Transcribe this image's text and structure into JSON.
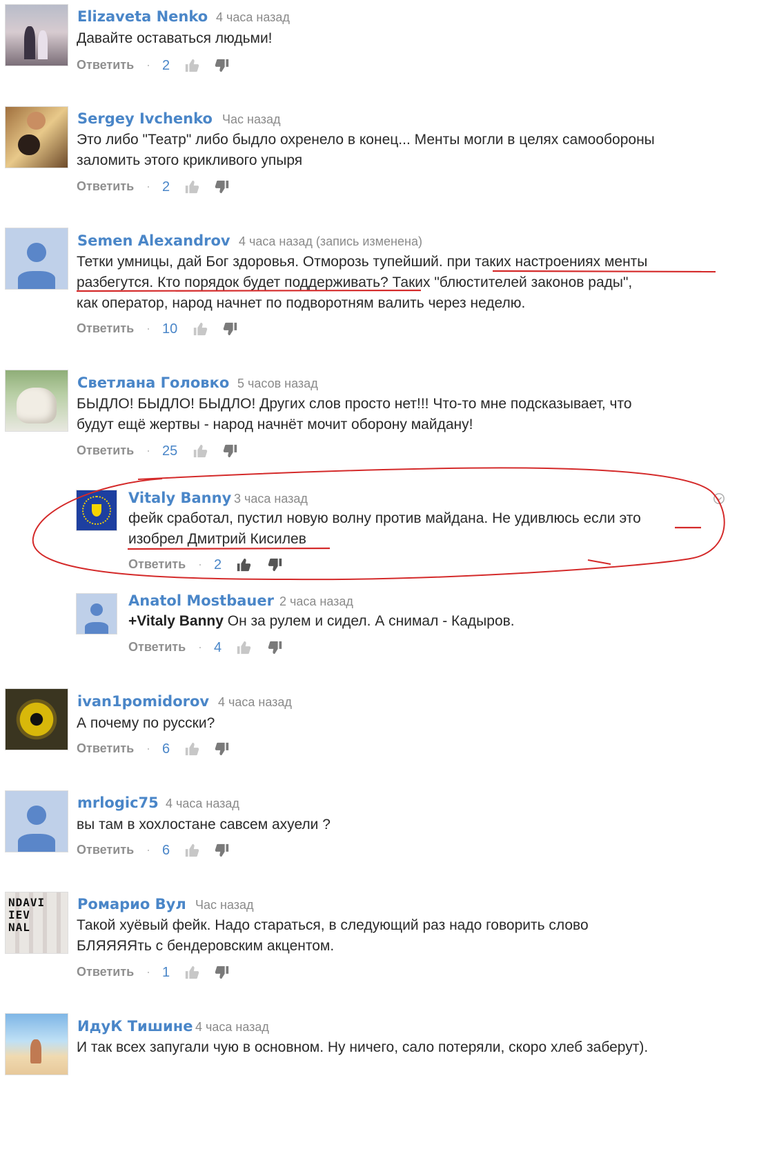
{
  "comments": [
    {
      "author": "Elizaveta Nenko",
      "time": "4 часа назад",
      "lines": [
        "Давайте оставаться людьми!"
      ],
      "reply": "Ответить",
      "likes": "2",
      "avatar": "street-photo"
    },
    {
      "author": "Sergey Ivchenko",
      "time": "Час назад",
      "lines": [
        "Это либо \"Театр\" либо быдло охренело в конец... Менты могли в целях самообороны",
        "заломить этого крикливого упыря"
      ],
      "reply": "Ответить",
      "likes": "2",
      "avatar": "people-photo"
    },
    {
      "author": "Semen Alexandrov",
      "time": "4 часа назад (запись изменена)",
      "lines": [
        "Тетки умницы, дай Бог здоровья. Отморозь тупейший. при таких настроениях менты",
        "разбегутся. Кто порядок будет поддерживать? Таких \"блюстителей законов рады\",",
        "как оператор, народ начнет по подворотням валить через неделю."
      ],
      "reply": "Ответить",
      "likes": "10",
      "avatar": "default"
    },
    {
      "author": "Светлана Головко",
      "time": "5 часов назад",
      "lines": [
        "БЫДЛО! БЫДЛО! БЫДЛО! Других слов просто нет!!! Что-то мне подсказывает, что",
        "будут ещё жертвы - народ начнёт мочит оборону майдану!"
      ],
      "reply": "Ответить",
      "likes": "25",
      "avatar": "dog-photo"
    },
    {
      "author": "Vitaly Banny",
      "time": "3 часа назад",
      "lines": [
        "фейк сработал, пустил новую волну против майдана. Не удивлюсь если это",
        "изобрел Дмитрий Кисилев"
      ],
      "reply": "Ответить",
      "likes": "2",
      "avatar": "eu-flag"
    },
    {
      "author": "Anatol Mostbauer",
      "time": "2 часа назад",
      "mention": "+Vitaly Banny",
      "lines": [
        " Он за рулем и сидел. А снимал - Кадыров."
      ],
      "reply": "Ответить",
      "likes": "4",
      "avatar": "default"
    },
    {
      "author": "ivan1pomidorov",
      "time": "4 часа назад",
      "lines": [
        "А почему по русски?"
      ],
      "reply": "Ответить",
      "likes": "6",
      "avatar": "eye-photo"
    },
    {
      "author": "mrlogic75",
      "time": "4 часа назад",
      "lines": [
        "вы там в хохлостане савсем ахуели ?"
      ],
      "reply": "Ответить",
      "likes": "6",
      "avatar": "default"
    },
    {
      "author": "Ромарио Вул",
      "time": "Час назад",
      "lines": [
        "Такой хуёвый фейк. Надо стараться, в следующий раз надо говорить слово",
        "БЛЯЯЯЯть с бендеровским акцентом."
      ],
      "reply": "Ответить",
      "likes": "1",
      "avatar": "poster-photo"
    },
    {
      "author": "ИдуК Тишине",
      "time": "4 часа назад",
      "lines": [
        "И так всех запугали чую в основном. Ну ничего, сало потеряли, скоро хлеб заберут)."
      ],
      "reply": "Ответить",
      "likes": "",
      "avatar": "beach-photo"
    }
  ],
  "poster_avatar_text": "NDAVI\nIEV\nNAL",
  "colors": {
    "author": "#4a86c8",
    "annotation": "#d42a2a",
    "meta": "#8a8a8a"
  }
}
